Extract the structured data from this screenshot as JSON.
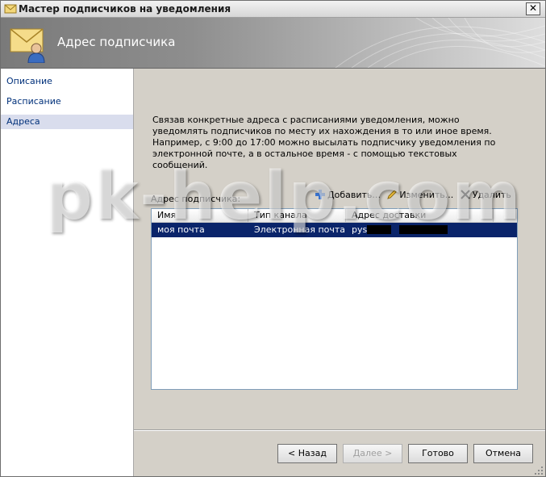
{
  "window": {
    "title": "Мастер подписчиков на уведомления",
    "close_glyph": "✕"
  },
  "header": {
    "title": "Адрес подписчика"
  },
  "sidebar": {
    "items": [
      {
        "label": "Описание",
        "selected": false
      },
      {
        "label": "Расписание",
        "selected": false
      },
      {
        "label": "Адреса",
        "selected": true
      }
    ]
  },
  "content": {
    "description": "Связав конкретные адреса с расписаниями уведомления, можно уведомлять подписчиков по месту их нахождения в то или иное время. Например, с 9:00 до 17:00 можно высылать подписчику уведомления по электронной почте, а в остальное время - с помощью текстовых сообщений.",
    "address_label": "Адрес подписчика:",
    "toolbar": {
      "add_label": "Добавить...",
      "edit_label": "Изменить...",
      "delete_label": "Удалить"
    },
    "table": {
      "columns": [
        "Имя",
        "Тип канала",
        "Адрес доставки"
      ],
      "rows": [
        {
          "name": "моя почта",
          "channel": "Электронная почта ...",
          "address": "pys[redacted]@[redacted]",
          "address_visible_start": "pys",
          "selected": true
        }
      ]
    }
  },
  "footer": {
    "back_label": "< Назад",
    "next_label": "Далее >",
    "finish_label": "Готово",
    "cancel_label": "Отмена"
  },
  "watermark": "pk-help.com",
  "colors": {
    "selection": "#0a246a",
    "link": "#00307a",
    "sidebar_selected": "#d9dded",
    "dialog_bg": "#d4d0c8"
  }
}
